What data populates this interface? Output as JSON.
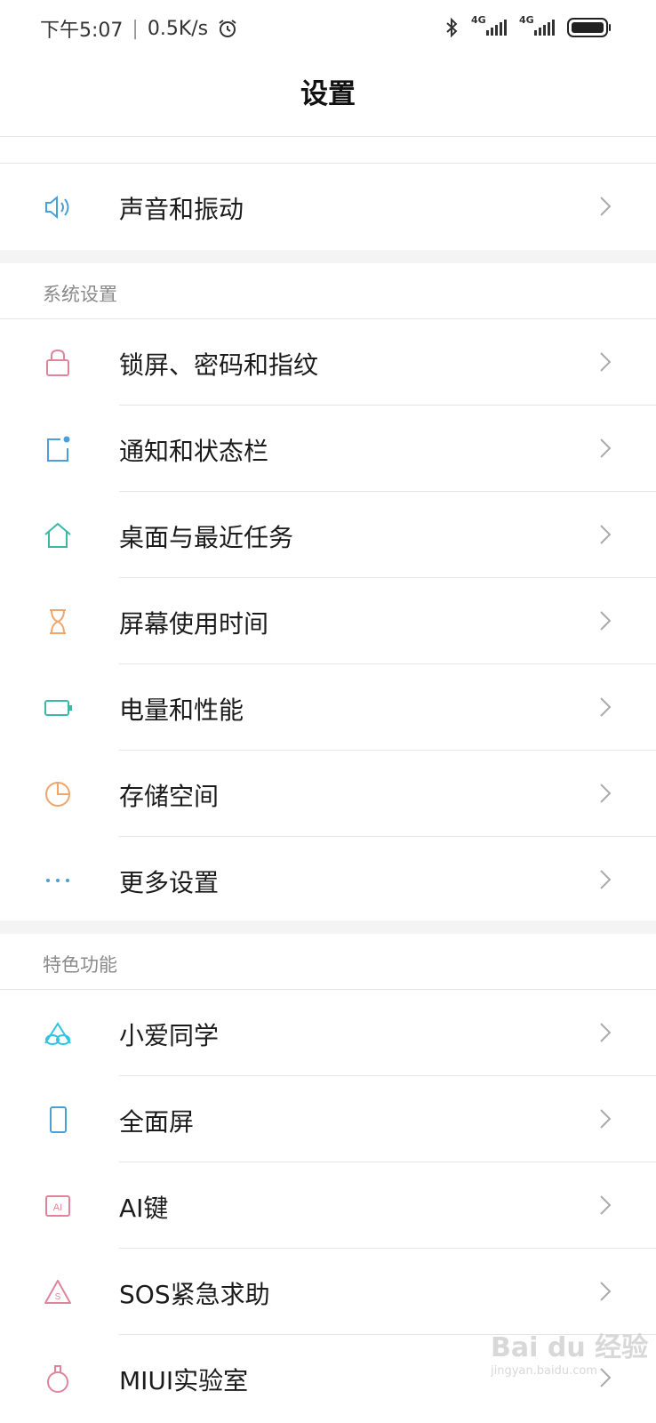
{
  "status_bar": {
    "time": "下午5:07",
    "speed": "0.5K/s",
    "sim1": "4G",
    "sim2": "4G"
  },
  "page": {
    "title": "设置"
  },
  "sections": {
    "sound": {
      "label": "声音和振动",
      "icon": "speaker-icon"
    },
    "system": {
      "header": "系统设置",
      "items": [
        {
          "label": "锁屏、密码和指纹",
          "icon": "lock-icon"
        },
        {
          "label": "通知和状态栏",
          "icon": "notification-icon"
        },
        {
          "label": "桌面与最近任务",
          "icon": "home-icon"
        },
        {
          "label": "屏幕使用时间",
          "icon": "hourglass-icon"
        },
        {
          "label": "电量和性能",
          "icon": "battery-icon"
        },
        {
          "label": "存储空间",
          "icon": "pie-chart-icon"
        },
        {
          "label": "更多设置",
          "icon": "more-dots-icon"
        }
      ]
    },
    "features": {
      "header": "特色功能",
      "items": [
        {
          "label": "小爱同学",
          "icon": "xiaoai-icon"
        },
        {
          "label": "全面屏",
          "icon": "phone-screen-icon"
        },
        {
          "label": "AI键",
          "icon": "ai-key-icon"
        },
        {
          "label": "SOS紧急求助",
          "icon": "sos-icon"
        },
        {
          "label": "MIUI实验室",
          "icon": "flask-icon"
        }
      ]
    }
  },
  "watermark": {
    "brand": "Bai du 经验",
    "url": "jingyan.baidu.com"
  },
  "colors": {
    "blue": "#4a9fd8",
    "pink": "#e0849b",
    "teal": "#3bb8a8",
    "orange": "#f0a56a",
    "cyan": "#2cc5e0"
  }
}
